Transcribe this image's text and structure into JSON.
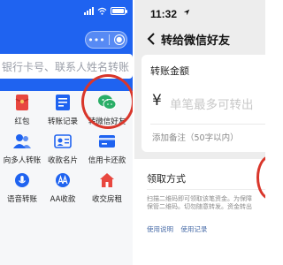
{
  "left": {
    "search": {
      "placeholder": "银行卡号、联系人姓名转账"
    },
    "capsule": {
      "more": "•••"
    },
    "grid": [
      {
        "label": "红包",
        "icon": "red-envelope-icon",
        "color": "#e8473f"
      },
      {
        "label": "转账记录",
        "icon": "transfer-record-icon",
        "color": "#1f63f0"
      },
      {
        "label": "转微信好友",
        "icon": "wechat-icon",
        "color": "#2aae67"
      },
      {
        "label": "向多人转账",
        "icon": "multi-user-icon",
        "color": "#1f63f0"
      },
      {
        "label": "收款名片",
        "icon": "id-card-icon",
        "color": "#1f63f0"
      },
      {
        "label": "信用卡还款",
        "icon": "credit-card-icon",
        "color": "#1f63f0"
      },
      {
        "label": "语音转账",
        "icon": "voice-icon",
        "color": "#1f63f0"
      },
      {
        "label": "AA收款",
        "icon": "aa-collect-icon",
        "color": "#1f63f0"
      },
      {
        "label": "收交房租",
        "icon": "house-rent-icon",
        "color": "#e8473f"
      }
    ]
  },
  "right": {
    "time": "11:32",
    "title": "转给微信好友",
    "amount_label": "转账金额",
    "currency_symbol": "¥",
    "amount_placeholder": "单笔最多可转出",
    "remark": "添加备注（50字以内）",
    "method_label": "领取方式",
    "method_desc": [
      "扫描二维码即可领取该笔资金。为保障",
      "保管二维码。切勿随意转发。资金转出"
    ],
    "links": [
      "使用说明",
      "使用记录"
    ]
  },
  "colors": {
    "brand_blue": "#1f63f0",
    "highlight_red": "#d9362b",
    "wechat_green": "#2aae67"
  }
}
